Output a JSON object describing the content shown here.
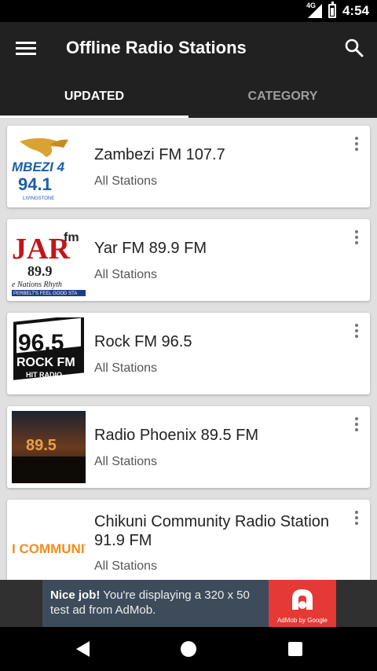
{
  "status_bar": {
    "time": "4:54",
    "network": "4G"
  },
  "app_bar": {
    "title": "Offline Radio Stations"
  },
  "tabs": [
    {
      "label": "UPDATED",
      "active": true
    },
    {
      "label": "CATEGORY",
      "active": false
    }
  ],
  "stations": [
    {
      "name": "Zambezi FM 107.7",
      "category": "All Stations",
      "logo_text_1": "MBEZI 4",
      "logo_text_2": "94.1",
      "logo_text_3": "LIVINGSTONE"
    },
    {
      "name": "Yar FM 89.9 FM",
      "category": "All Stations",
      "logo_text_1": "JAR",
      "logo_text_2": "fm",
      "logo_text_3": "89.9",
      "logo_text_4": "e Nations Rhyth",
      "logo_text_5": "PERBELT'S FEEL GOOD STA"
    },
    {
      "name": "Rock FM 96.5",
      "category": "All Stations",
      "logo_text_1": "96.5",
      "logo_text_2": "ROCK FM",
      "logo_text_3": "HIT RADIO"
    },
    {
      "name": "Radio Phoenix 89.5 FM",
      "category": "All Stations",
      "logo_text_1": "89.5"
    },
    {
      "name": "Chikuni Community Radio Station 91.9 FM",
      "category": "All Stations",
      "logo_text_1": "I COMMUNIT"
    }
  ],
  "ad": {
    "bold": "Nice job!",
    "text": " You're displaying a 320 x 50 test ad from AdMob.",
    "brand": "AdMob by Google"
  },
  "colors": {
    "app_bar": "#212121",
    "ad_bg": "#3d4b5a",
    "ad_logo": "#e53935"
  }
}
